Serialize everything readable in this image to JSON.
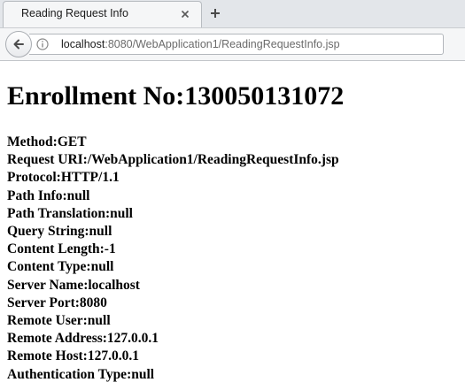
{
  "browser": {
    "tab": {
      "title": "Reading Request Info"
    },
    "address_bar": {
      "host": "localhost",
      "rest": ":8080/WebApplication1/ReadingRequestInfo.jsp"
    }
  },
  "page": {
    "heading": "Enrollment No:130050131072",
    "lines": [
      "Method:GET",
      "Request URI:/WebApplication1/ReadingRequestInfo.jsp",
      "Protocol:HTTP/1.1",
      "Path Info:null",
      "Path Translation:null",
      "Query String:null",
      "Content Length:-1",
      "Content Type:null",
      "Server Name:localhost",
      "Server Port:8080",
      "Remote User:null",
      "Remote Address:127.0.0.1",
      "Remote Host:127.0.0.1",
      "Authentication Type:null"
    ]
  },
  "icons": {
    "tab_close": "close-icon",
    "new_tab": "plus-icon",
    "back": "back-arrow-icon",
    "site_info": "info-icon"
  }
}
